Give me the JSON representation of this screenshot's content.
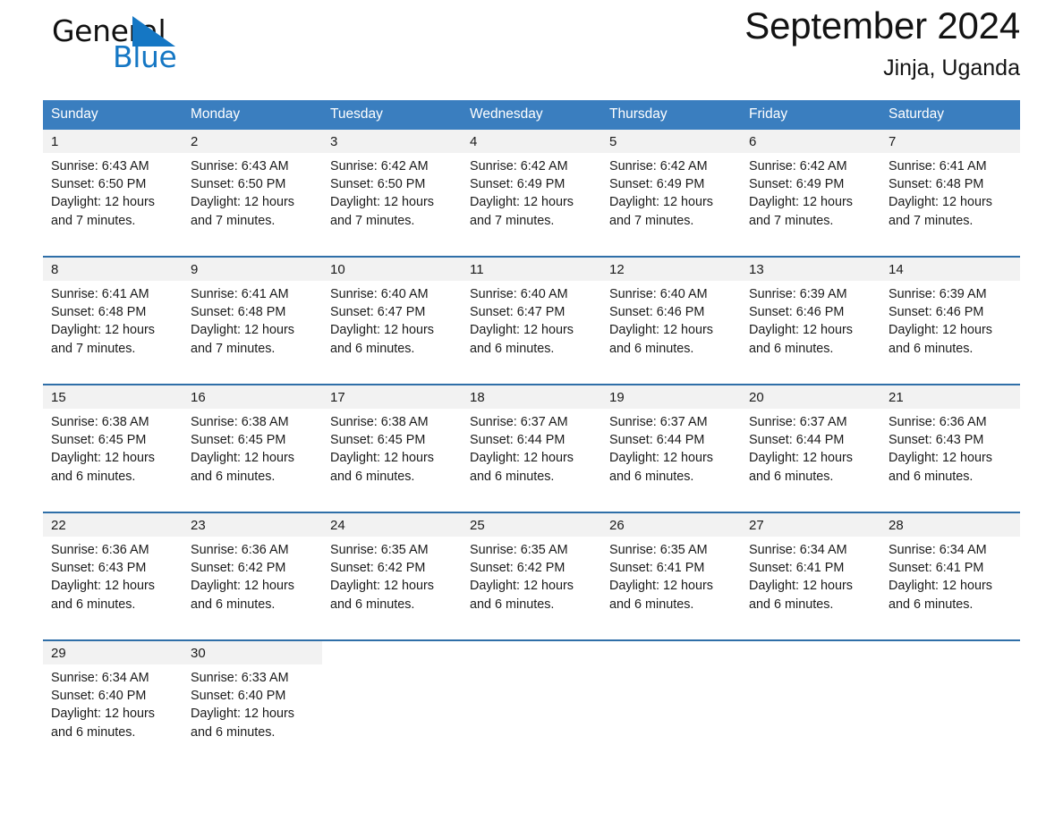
{
  "brand": {
    "name_part1": "General",
    "name_part2": "Blue",
    "triangle_color": "#1577c4"
  },
  "header": {
    "title": "September 2024",
    "location": "Jinja, Uganda"
  },
  "theme": {
    "header_blue": "#3a7ebf",
    "rule_blue": "#2f6fa8",
    "daynum_bg": "#f2f2f2",
    "text": "#1b1b1b"
  },
  "weekdays": [
    "Sunday",
    "Monday",
    "Tuesday",
    "Wednesday",
    "Thursday",
    "Friday",
    "Saturday"
  ],
  "calendar_data": {
    "month": "September",
    "year": 2024,
    "location": "Jinja, Uganda",
    "weeks": [
      [
        {
          "day": "1",
          "sunrise": "Sunrise: 6:43 AM",
          "sunset": "Sunset: 6:50 PM",
          "daylight_a": "Daylight: 12 hours",
          "daylight_b": "and 7 minutes."
        },
        {
          "day": "2",
          "sunrise": "Sunrise: 6:43 AM",
          "sunset": "Sunset: 6:50 PM",
          "daylight_a": "Daylight: 12 hours",
          "daylight_b": "and 7 minutes."
        },
        {
          "day": "3",
          "sunrise": "Sunrise: 6:42 AM",
          "sunset": "Sunset: 6:50 PM",
          "daylight_a": "Daylight: 12 hours",
          "daylight_b": "and 7 minutes."
        },
        {
          "day": "4",
          "sunrise": "Sunrise: 6:42 AM",
          "sunset": "Sunset: 6:49 PM",
          "daylight_a": "Daylight: 12 hours",
          "daylight_b": "and 7 minutes."
        },
        {
          "day": "5",
          "sunrise": "Sunrise: 6:42 AM",
          "sunset": "Sunset: 6:49 PM",
          "daylight_a": "Daylight: 12 hours",
          "daylight_b": "and 7 minutes."
        },
        {
          "day": "6",
          "sunrise": "Sunrise: 6:42 AM",
          "sunset": "Sunset: 6:49 PM",
          "daylight_a": "Daylight: 12 hours",
          "daylight_b": "and 7 minutes."
        },
        {
          "day": "7",
          "sunrise": "Sunrise: 6:41 AM",
          "sunset": "Sunset: 6:48 PM",
          "daylight_a": "Daylight: 12 hours",
          "daylight_b": "and 7 minutes."
        }
      ],
      [
        {
          "day": "8",
          "sunrise": "Sunrise: 6:41 AM",
          "sunset": "Sunset: 6:48 PM",
          "daylight_a": "Daylight: 12 hours",
          "daylight_b": "and 7 minutes."
        },
        {
          "day": "9",
          "sunrise": "Sunrise: 6:41 AM",
          "sunset": "Sunset: 6:48 PM",
          "daylight_a": "Daylight: 12 hours",
          "daylight_b": "and 7 minutes."
        },
        {
          "day": "10",
          "sunrise": "Sunrise: 6:40 AM",
          "sunset": "Sunset: 6:47 PM",
          "daylight_a": "Daylight: 12 hours",
          "daylight_b": "and 6 minutes."
        },
        {
          "day": "11",
          "sunrise": "Sunrise: 6:40 AM",
          "sunset": "Sunset: 6:47 PM",
          "daylight_a": "Daylight: 12 hours",
          "daylight_b": "and 6 minutes."
        },
        {
          "day": "12",
          "sunrise": "Sunrise: 6:40 AM",
          "sunset": "Sunset: 6:46 PM",
          "daylight_a": "Daylight: 12 hours",
          "daylight_b": "and 6 minutes."
        },
        {
          "day": "13",
          "sunrise": "Sunrise: 6:39 AM",
          "sunset": "Sunset: 6:46 PM",
          "daylight_a": "Daylight: 12 hours",
          "daylight_b": "and 6 minutes."
        },
        {
          "day": "14",
          "sunrise": "Sunrise: 6:39 AM",
          "sunset": "Sunset: 6:46 PM",
          "daylight_a": "Daylight: 12 hours",
          "daylight_b": "and 6 minutes."
        }
      ],
      [
        {
          "day": "15",
          "sunrise": "Sunrise: 6:38 AM",
          "sunset": "Sunset: 6:45 PM",
          "daylight_a": "Daylight: 12 hours",
          "daylight_b": "and 6 minutes."
        },
        {
          "day": "16",
          "sunrise": "Sunrise: 6:38 AM",
          "sunset": "Sunset: 6:45 PM",
          "daylight_a": "Daylight: 12 hours",
          "daylight_b": "and 6 minutes."
        },
        {
          "day": "17",
          "sunrise": "Sunrise: 6:38 AM",
          "sunset": "Sunset: 6:45 PM",
          "daylight_a": "Daylight: 12 hours",
          "daylight_b": "and 6 minutes."
        },
        {
          "day": "18",
          "sunrise": "Sunrise: 6:37 AM",
          "sunset": "Sunset: 6:44 PM",
          "daylight_a": "Daylight: 12 hours",
          "daylight_b": "and 6 minutes."
        },
        {
          "day": "19",
          "sunrise": "Sunrise: 6:37 AM",
          "sunset": "Sunset: 6:44 PM",
          "daylight_a": "Daylight: 12 hours",
          "daylight_b": "and 6 minutes."
        },
        {
          "day": "20",
          "sunrise": "Sunrise: 6:37 AM",
          "sunset": "Sunset: 6:44 PM",
          "daylight_a": "Daylight: 12 hours",
          "daylight_b": "and 6 minutes."
        },
        {
          "day": "21",
          "sunrise": "Sunrise: 6:36 AM",
          "sunset": "Sunset: 6:43 PM",
          "daylight_a": "Daylight: 12 hours",
          "daylight_b": "and 6 minutes."
        }
      ],
      [
        {
          "day": "22",
          "sunrise": "Sunrise: 6:36 AM",
          "sunset": "Sunset: 6:43 PM",
          "daylight_a": "Daylight: 12 hours",
          "daylight_b": "and 6 minutes."
        },
        {
          "day": "23",
          "sunrise": "Sunrise: 6:36 AM",
          "sunset": "Sunset: 6:42 PM",
          "daylight_a": "Daylight: 12 hours",
          "daylight_b": "and 6 minutes."
        },
        {
          "day": "24",
          "sunrise": "Sunrise: 6:35 AM",
          "sunset": "Sunset: 6:42 PM",
          "daylight_a": "Daylight: 12 hours",
          "daylight_b": "and 6 minutes."
        },
        {
          "day": "25",
          "sunrise": "Sunrise: 6:35 AM",
          "sunset": "Sunset: 6:42 PM",
          "daylight_a": "Daylight: 12 hours",
          "daylight_b": "and 6 minutes."
        },
        {
          "day": "26",
          "sunrise": "Sunrise: 6:35 AM",
          "sunset": "Sunset: 6:41 PM",
          "daylight_a": "Daylight: 12 hours",
          "daylight_b": "and 6 minutes."
        },
        {
          "day": "27",
          "sunrise": "Sunrise: 6:34 AM",
          "sunset": "Sunset: 6:41 PM",
          "daylight_a": "Daylight: 12 hours",
          "daylight_b": "and 6 minutes."
        },
        {
          "day": "28",
          "sunrise": "Sunrise: 6:34 AM",
          "sunset": "Sunset: 6:41 PM",
          "daylight_a": "Daylight: 12 hours",
          "daylight_b": "and 6 minutes."
        }
      ],
      [
        {
          "day": "29",
          "sunrise": "Sunrise: 6:34 AM",
          "sunset": "Sunset: 6:40 PM",
          "daylight_a": "Daylight: 12 hours",
          "daylight_b": "and 6 minutes."
        },
        {
          "day": "30",
          "sunrise": "Sunrise: 6:33 AM",
          "sunset": "Sunset: 6:40 PM",
          "daylight_a": "Daylight: 12 hours",
          "daylight_b": "and 6 minutes."
        },
        null,
        null,
        null,
        null,
        null
      ]
    ]
  }
}
